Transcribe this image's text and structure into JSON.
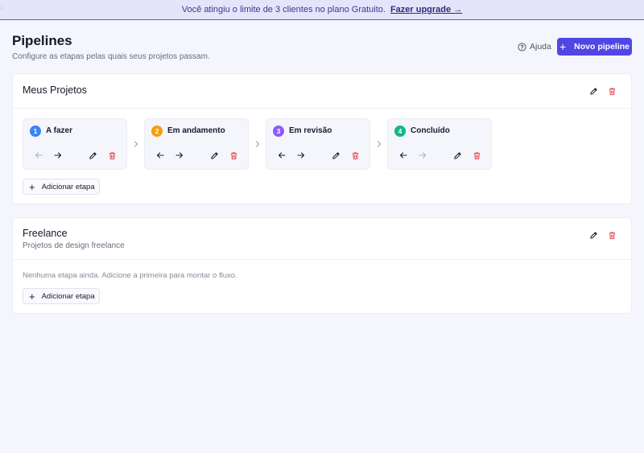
{
  "banner": {
    "text": "Você atingiu o limite de 3 clientes no plano Gratuito.",
    "link": "Fazer upgrade →"
  },
  "header": {
    "title": "Pipelines",
    "subtitle": "Configure as etapas pelas quais seus projetos passam.",
    "help": "Ajuda",
    "new_pipeline": "Novo pipeline"
  },
  "pipelines": [
    {
      "name": "Meus Projetos",
      "description": "",
      "stages": [
        {
          "number": "1",
          "name": "A fazer",
          "color": "#3b82f6"
        },
        {
          "number": "2",
          "name": "Em andamento",
          "color": "#f59e0b"
        },
        {
          "number": "3",
          "name": "Em revisão",
          "color": "#8b5cf6"
        },
        {
          "number": "4",
          "name": "Concluído",
          "color": "#10b981"
        }
      ],
      "add_stage": "Adicionar etapa"
    },
    {
      "name": "Freelance",
      "description": "Projetos de design freelance",
      "empty_message": "Nenhuma etapa ainda. Adicione a primeira para montar o fluxo.",
      "add_stage": "Adicionar etapa"
    }
  ],
  "icons": {
    "edit": "pencil-icon",
    "delete": "trash-icon",
    "move_left": "arrow-left-icon",
    "move_right": "arrow-right-icon",
    "separator": "chevron-right-icon",
    "help": "question-circle-icon",
    "add": "plus-icon"
  },
  "colors": {
    "accent": "#5046e5",
    "danger": "#e5484d",
    "banner_bg": "#e4e4fa"
  }
}
